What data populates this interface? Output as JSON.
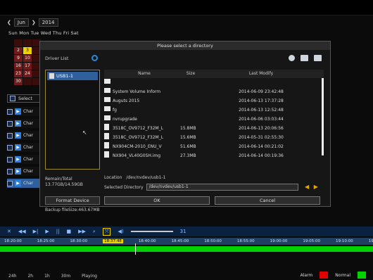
{
  "calendar": {
    "month": "Jun",
    "year": "2014",
    "weekdays": "Sun Mon Tue Wed Thu Fri Sat",
    "days": [
      "",
      "",
      "",
      "2",
      "3",
      "",
      "9",
      "10",
      "",
      "16",
      "17",
      "",
      "23",
      "24",
      "",
      "30",
      "",
      ""
    ],
    "selected_day": "3"
  },
  "select_label": "Select",
  "channels": [
    "Char",
    "Char",
    "Char",
    "Char",
    "Char",
    "Char",
    "Char"
  ],
  "dialog": {
    "title": "Please select a directory",
    "driver_list_label": "Driver List",
    "drive_name": "USB1-1",
    "columns": [
      "Name",
      "Size",
      "Last Modify"
    ],
    "rows": [
      {
        "type": "folder",
        "name": "",
        "size": "",
        "modified": ""
      },
      {
        "type": "folder",
        "name": "System Volume Inform",
        "size": "",
        "modified": "2014-06-09 23:42:48"
      },
      {
        "type": "folder",
        "name": "Auguts 2015",
        "size": "",
        "modified": "2014-06-13 17:37:28"
      },
      {
        "type": "folder",
        "name": "fg",
        "size": "",
        "modified": "2014-06-13 12:52:48"
      },
      {
        "type": "folder",
        "name": "nvrupgrade",
        "size": "",
        "modified": "2014-06-06 03:03:44"
      },
      {
        "type": "file",
        "name": "3518C_OV9712_F32M_L",
        "size": "15.8MB",
        "modified": "2014-06-13 20:06:56"
      },
      {
        "type": "file",
        "name": "3518C_OV9712_F32M_L",
        "size": "15.6MB",
        "modified": "2014-05-31 02:55:30"
      },
      {
        "type": "file",
        "name": "NX904CM-2010_ENU_V",
        "size": "51.6MB",
        "modified": "2014-06-14 00:21:02"
      },
      {
        "type": "file",
        "name": "NX904_VL40G0SH.img",
        "size": "27.3MB",
        "modified": "2014-06-14 00:19:36"
      }
    ],
    "remain_total_label": "Remain/Total",
    "remain_total_value": "13.77GB/14.59GB",
    "format_button": "Format Device",
    "backup_size": "Backup fileSize:463.67MB",
    "location_label": "Location",
    "location_value": "/dev/nvdev/usb1-1",
    "selected_dir_label": "Selected Directory",
    "selected_dir_value": "/dev/nvdev/usb1-1",
    "ok_button": "OK",
    "cancel_button": "Cancel"
  },
  "playback": {
    "volume_value": "31",
    "times": [
      "18:20:00",
      "18:25:00",
      "18:30:00",
      "18:37:48",
      "18:40:00",
      "18:45:00",
      "18:50:00",
      "18:55:00",
      "19:00:00",
      "19:05:00",
      "19:10:00",
      "19:15:00"
    ],
    "current_time": "18:37:48",
    "zoom_options": [
      "24h",
      "2h",
      "1h",
      "30m"
    ],
    "status": "Playing",
    "legend_alarm": "Alarm",
    "legend_normal": "Normal",
    "alarm_color": "#e00000",
    "normal_color": "#00d200"
  }
}
